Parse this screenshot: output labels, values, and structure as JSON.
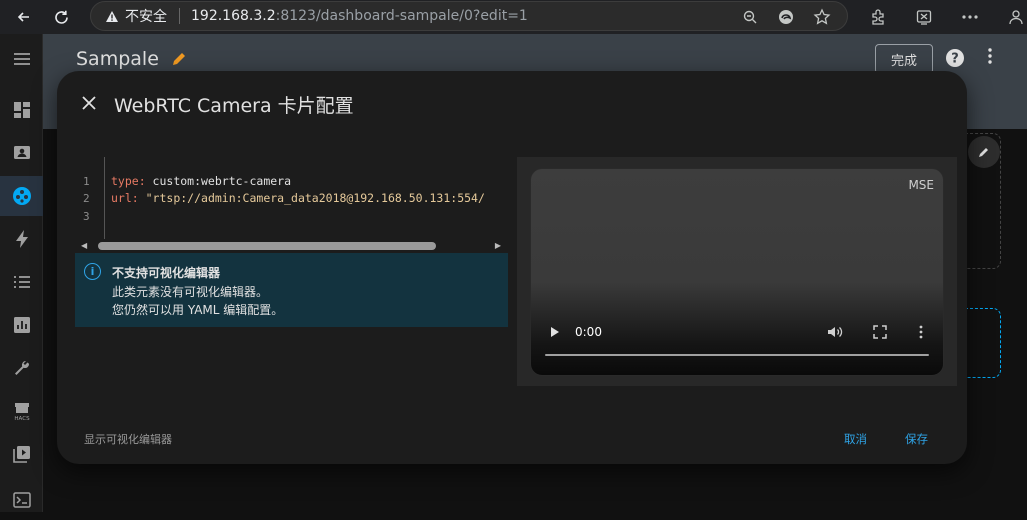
{
  "browser": {
    "security_label": "不安全",
    "url_host": "192.168.3.2",
    "url_rest": ":8123/dashboard-sampale/0?edit=1"
  },
  "ha": {
    "dashboard_title": "Sampale",
    "done_label": "完成",
    "sidebar_icons": [
      "menu-icon",
      "overview-icon",
      "map-icon",
      "logbook-icon",
      "energy-icon",
      "todo-icon",
      "history-icon",
      "tools-icon",
      "hacs-icon",
      "media-icon",
      "terminal-icon"
    ],
    "hacs_label": "HACS"
  },
  "dialog": {
    "title": "WebRTC Camera 卡片配置",
    "code": {
      "line_numbers": [
        "1",
        "2",
        "3"
      ],
      "line1_key": "type:",
      "line1_value": " custom:webrtc-camera",
      "line2_key": "url:",
      "line2_value": " \"rtsp://admin:Camera_data2018@192.168.50.131:554/"
    },
    "info": {
      "title": "不支持可视化编辑器",
      "line1": "此类元素没有可视化编辑器。",
      "line2": "您仍然可以用 YAML 编辑配置。"
    },
    "preview": {
      "mode": "MSE",
      "time": "0:00",
      "progress": 0
    },
    "footer": {
      "toggle_label": "显示可视化编辑器",
      "cancel_label": "取消",
      "save_label": "保存"
    }
  },
  "colors": {
    "accent": "#03a9f4",
    "link": "#2fa4e7",
    "edit_pencil": "#f29b22",
    "yaml_key": "#e77a64",
    "yaml_string": "#e5c99a"
  }
}
